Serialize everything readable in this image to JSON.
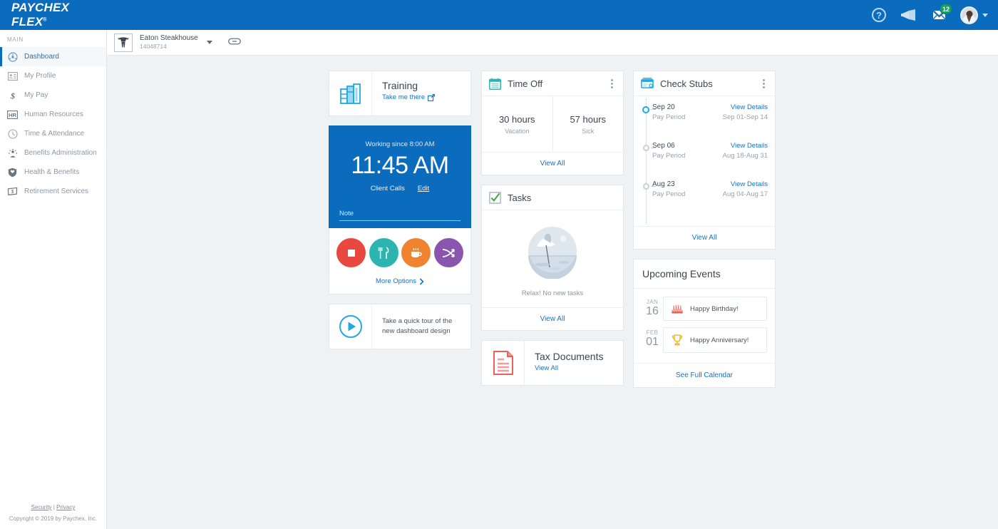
{
  "brand": {
    "name": "PAYCHEX FLEX",
    "trademark": "®"
  },
  "topbar": {
    "help_icon": "help-circle-icon",
    "announcement_icon": "megaphone-icon",
    "messages_icon": "envelope-icon",
    "messages_badge": "12",
    "avatar_icon": "user-avatar",
    "profile_caret": "chevron-down-icon"
  },
  "sidebar": {
    "section_label": "MAIN",
    "items": [
      {
        "label": "Dashboard",
        "icon": "dashboard-gauge-icon",
        "active": true
      },
      {
        "label": "My Profile",
        "icon": "id-card-icon",
        "active": false
      },
      {
        "label": "My Pay",
        "icon": "dollar-sign-icon",
        "active": false
      },
      {
        "label": "Human Resources",
        "icon": "hr-badge-icon",
        "active": false
      },
      {
        "label": "Time & Attendance",
        "icon": "clock-icon",
        "active": false
      },
      {
        "label": "Benefits Administration",
        "icon": "benefits-gear-icon",
        "active": false
      },
      {
        "label": "Health & Benefits",
        "icon": "shield-heart-icon",
        "active": false
      },
      {
        "label": "Retirement Services",
        "icon": "retirement-money-icon",
        "active": false
      }
    ],
    "footer": {
      "security": "Security",
      "separator": "|",
      "privacy": "Privacy",
      "copyright": "Copyright © 2019 by Paychex, Inc."
    }
  },
  "subheader": {
    "company_logo": "steakhouse-logo",
    "company_name": "Eaton Steakhouse",
    "company_id": "14048714",
    "dropdown_icon": "chevron-down-icon",
    "link_icon": "link-chain-icon"
  },
  "training": {
    "icon": "books-shelf-icon",
    "title": "Training",
    "link_label": "Take me there",
    "external_icon": "external-link-icon"
  },
  "clock": {
    "working_since": "Working since 8:00 AM",
    "time": "11:45 AM",
    "activity": "Client Calls",
    "edit_label": "Edit",
    "note_placeholder": "Note",
    "note_value": "",
    "buttons": [
      {
        "name": "stop-button",
        "icon": "stop-square-icon",
        "color": "#e8483f"
      },
      {
        "name": "meal-button",
        "icon": "fork-knife-icon",
        "color": "#2cb5b0"
      },
      {
        "name": "break-button",
        "icon": "coffee-cup-icon",
        "color": "#f08330"
      },
      {
        "name": "transfer-button",
        "icon": "shuffle-arrows-icon",
        "color": "#8a55ad"
      }
    ],
    "more_options": "More Options",
    "more_options_icon": "chevron-right-icon"
  },
  "tour": {
    "play_icon": "play-circle-icon",
    "text": "Take a quick tour of the new dashboard design"
  },
  "time_off": {
    "icon": "calendar-icon",
    "title": "Time Off",
    "kebab_icon": "kebab-menu-icon",
    "stats": [
      {
        "value": "30 hours",
        "label": "Vacation"
      },
      {
        "value": "57 hours",
        "label": "Sick"
      }
    ],
    "view_all": "View All"
  },
  "tasks": {
    "icon": "checkbox-check-icon",
    "title": "Tasks",
    "illustration": "beach-umbrella-illustration",
    "empty_text": "Relax! No new tasks",
    "view_all": "View All"
  },
  "tax_documents": {
    "icon": "document-lines-icon",
    "title": "Tax Documents",
    "view_all": "View All"
  },
  "check_stubs": {
    "icon": "check-card-icon",
    "title": "Check Stubs",
    "kebab_icon": "kebab-menu-icon",
    "entries": [
      {
        "date": "Sep 20",
        "period_label": "Pay Period",
        "range": "Sep 01-Sep 14",
        "details": "View Details",
        "current": true
      },
      {
        "date": "Sep 06",
        "period_label": "Pay Period",
        "range": "Aug 18-Aug 31",
        "details": "View Details",
        "current": false
      },
      {
        "date": "Aug 23",
        "period_label": "Pay Period",
        "range": "Aug 04-Aug 17",
        "details": "View Details",
        "current": false
      }
    ],
    "view_all": "View All"
  },
  "upcoming_events": {
    "title": "Upcoming Events",
    "events": [
      {
        "month": "JAN",
        "day": "16",
        "text": "Happy Birthday!",
        "icon": "birthday-cake-icon"
      },
      {
        "month": "FEB",
        "day": "01",
        "text": "Happy Anniversary!",
        "icon": "trophy-icon"
      }
    ],
    "see_calendar": "See Full Calendar"
  },
  "colors": {
    "brand_blue": "#0b6bbd",
    "link_blue": "#1572c0",
    "canvas_bg": "#eff2f5",
    "badge_green": "#12a05c",
    "accent_cyan": "#17aee0"
  }
}
